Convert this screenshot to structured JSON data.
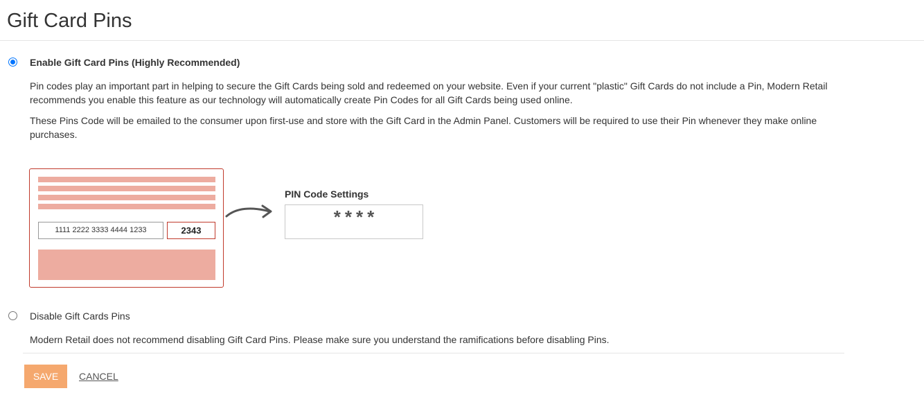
{
  "page": {
    "title": "Gift Card Pins"
  },
  "enable_option": {
    "label": "Enable Gift Card Pins (Highly Recommended)",
    "selected": true,
    "description_1": "Pin codes play an important part in helping to secure the Gift Cards being sold and redeemed on your website. Even if your current \"plastic\" Gift Cards do not include a Pin, Modern Retail recommends you enable this feature as our technology will automatically create Pin Codes for all Gift Cards being used online.",
    "description_2": "These Pins Code will be emailed to the consumer upon first-use and store with the Gift Card in the Admin Panel. Customers will be required to use their Pin whenever they make online purchases."
  },
  "illustration": {
    "card_number": "1111 2222 3333 4444 1233",
    "card_pin": "2343",
    "pin_settings_heading": "PIN Code Settings",
    "pin_mask": "****",
    "card_color": "#edaca0",
    "card_border_color": "#c0392b"
  },
  "disable_option": {
    "label": "Disable Gift Cards Pins",
    "selected": false,
    "description": "Modern Retail does not recommend disabling Gift Card Pins. Please make sure you understand the ramifications before disabling Pins."
  },
  "actions": {
    "save_label": "Save",
    "cancel_label": "Cancel",
    "save_color": "#f5a86e"
  },
  "icons": {
    "arrow": "curved-arrow-right-icon"
  }
}
